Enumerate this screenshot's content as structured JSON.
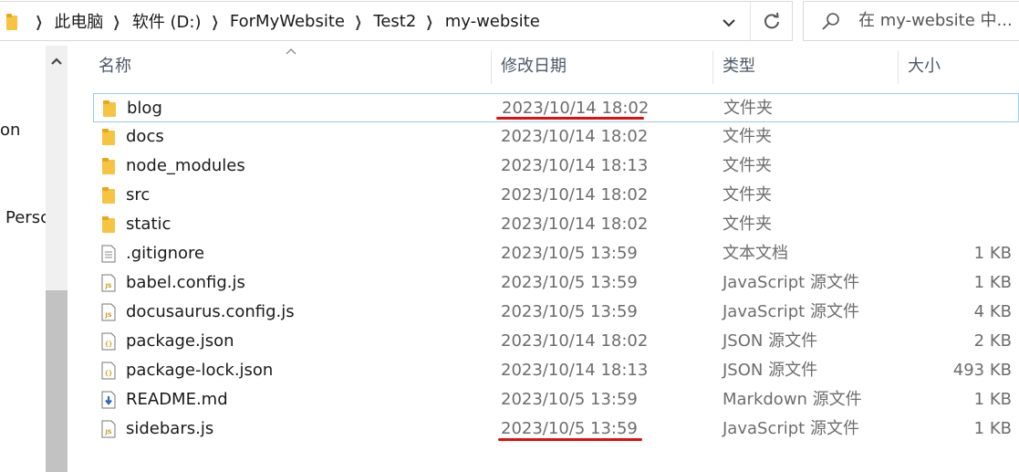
{
  "address": {
    "crumbs": [
      "此电脑",
      "软件 (D:)",
      "ForMyWebsite",
      "Test2",
      "my-website"
    ]
  },
  "search": {
    "placeholder": "在 my-website 中..."
  },
  "nav": {
    "items": [
      "on",
      "Persc"
    ]
  },
  "columns": {
    "name": "名称",
    "date": "修改日期",
    "type": "类型",
    "size": "大小"
  },
  "files": [
    {
      "name": "blog",
      "date": "2023/10/14 18:02",
      "type": "文件夹",
      "size": "",
      "icon": "folder-icon",
      "selected": true
    },
    {
      "name": "docs",
      "date": "2023/10/14 18:02",
      "type": "文件夹",
      "size": "",
      "icon": "folder-icon"
    },
    {
      "name": "node_modules",
      "date": "2023/10/14 18:13",
      "type": "文件夹",
      "size": "",
      "icon": "folder-icon"
    },
    {
      "name": "src",
      "date": "2023/10/14 18:02",
      "type": "文件夹",
      "size": "",
      "icon": "folder-icon"
    },
    {
      "name": "static",
      "date": "2023/10/14 18:02",
      "type": "文件夹",
      "size": "",
      "icon": "folder-icon"
    },
    {
      "name": ".gitignore",
      "date": "2023/10/5 13:59",
      "type": "文本文档",
      "size": "1 KB",
      "icon": "text-file-icon"
    },
    {
      "name": "babel.config.js",
      "date": "2023/10/5 13:59",
      "type": "JavaScript 源文件",
      "size": "1 KB",
      "icon": "js-file-icon"
    },
    {
      "name": "docusaurus.config.js",
      "date": "2023/10/5 13:59",
      "type": "JavaScript 源文件",
      "size": "4 KB",
      "icon": "js-file-icon"
    },
    {
      "name": "package.json",
      "date": "2023/10/14 18:02",
      "type": "JSON 源文件",
      "size": "2 KB",
      "icon": "json-file-icon"
    },
    {
      "name": "package-lock.json",
      "date": "2023/10/14 18:13",
      "type": "JSON 源文件",
      "size": "493 KB",
      "icon": "json-file-icon"
    },
    {
      "name": "README.md",
      "date": "2023/10/5 13:59",
      "type": "Markdown 源文件",
      "size": "1 KB",
      "icon": "markdown-file-icon"
    },
    {
      "name": "sidebars.js",
      "date": "2023/10/5 13:59",
      "type": "JavaScript 源文件",
      "size": "1 KB",
      "icon": "js-file-icon"
    }
  ],
  "colors": {
    "folder": "#f6c342",
    "selection_border": "#99c9ef",
    "annotation_red": "#e01010",
    "header_text": "#4d5a6a",
    "meta_text": "#6d6d6d"
  }
}
